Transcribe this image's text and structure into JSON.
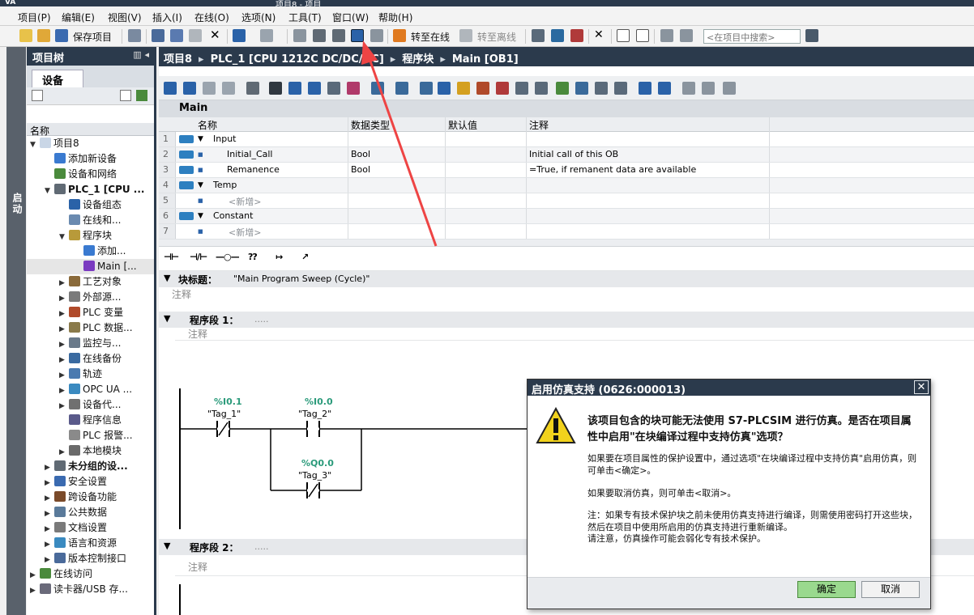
{
  "window": {
    "logo": "VA",
    "title": "项目8 - 项目"
  },
  "menu": [
    "项目(P)",
    "编辑(E)",
    "视图(V)",
    "插入(I)",
    "在线(O)",
    "选项(N)",
    "工具(T)",
    "窗口(W)",
    "帮助(H)"
  ],
  "toolbar": {
    "save_label": "保存项目",
    "go_online": "转至在线",
    "go_offline": "转至离线",
    "search_placeholder": "<在项目中搜索>"
  },
  "sidebar": {
    "vertical_tab": "启动"
  },
  "project_tree": {
    "title": "项目树",
    "controls": "▥ ◂",
    "tab": "设备",
    "column": "名称",
    "items": [
      {
        "label": "项目8",
        "indent": 0,
        "tw": "▼",
        "icon": "file-icon",
        "color": "#c9d6e6"
      },
      {
        "label": "添加新设备",
        "indent": 1,
        "tw": "",
        "icon": "add-device-icon",
        "color": "#3a7ad0"
      },
      {
        "label": "设备和网络",
        "indent": 1,
        "tw": "",
        "icon": "network-icon",
        "color": "#4a8a3c"
      },
      {
        "label": "PLC_1 [CPU ...",
        "indent": 1,
        "tw": "▼",
        "icon": "cpu-icon",
        "color": "#606a74",
        "bold": true
      },
      {
        "label": "设备组态",
        "indent": 2,
        "tw": "",
        "icon": "device-config-icon",
        "color": "#2a62a8"
      },
      {
        "label": "在线和...",
        "indent": 2,
        "tw": "",
        "icon": "online-diag-icon",
        "color": "#6a8ab0"
      },
      {
        "label": "程序块",
        "indent": 2,
        "tw": "▼",
        "icon": "program-blocks-icon",
        "color": "#b89a3a"
      },
      {
        "label": "添加...",
        "indent": 3,
        "tw": "",
        "icon": "add-block-icon",
        "color": "#3a7ad0"
      },
      {
        "label": "Main [...",
        "indent": 3,
        "tw": "",
        "icon": "ob-icon",
        "color": "#7a3ac0",
        "selected": true
      },
      {
        "label": "工艺对象",
        "indent": 2,
        "tw": "▶",
        "icon": "tech-object-icon",
        "color": "#8a6a3a"
      },
      {
        "label": "外部源...",
        "indent": 2,
        "tw": "▶",
        "icon": "external-source-icon",
        "color": "#7a7a7a"
      },
      {
        "label": "PLC 变量",
        "indent": 2,
        "tw": "▶",
        "icon": "plc-tags-icon",
        "color": "#b04a2a"
      },
      {
        "label": "PLC 数据...",
        "indent": 2,
        "tw": "▶",
        "icon": "plc-data-types-icon",
        "color": "#8a7a4a"
      },
      {
        "label": "监控与...",
        "indent": 2,
        "tw": "▶",
        "icon": "watch-table-icon",
        "color": "#6a7a8a"
      },
      {
        "label": "在线备份",
        "indent": 2,
        "tw": "▶",
        "icon": "online-backup-icon",
        "color": "#3a6aa0"
      },
      {
        "label": "轨迹",
        "indent": 2,
        "tw": "▶",
        "icon": "trace-icon",
        "color": "#4a7ab0"
      },
      {
        "label": "OPC UA ...",
        "indent": 2,
        "tw": "▶",
        "icon": "opc-ua-icon",
        "color": "#3a8ac0"
      },
      {
        "label": "设备代...",
        "indent": 2,
        "tw": "▶",
        "icon": "device-proxy-icon",
        "color": "#707070"
      },
      {
        "label": "程序信息",
        "indent": 2,
        "tw": "",
        "icon": "program-info-icon",
        "color": "#5a5a8a"
      },
      {
        "label": "PLC 报警...",
        "indent": 2,
        "tw": "",
        "icon": "plc-alarm-icon",
        "color": "#8a8a8a"
      },
      {
        "label": "本地模块",
        "indent": 2,
        "tw": "▶",
        "icon": "local-modules-icon",
        "color": "#6a6a6a"
      },
      {
        "label": "未分组的设...",
        "indent": 1,
        "tw": "▶",
        "icon": "ungrouped-devices-icon",
        "color": "#606a74",
        "bold": true
      },
      {
        "label": "安全设置",
        "indent": 1,
        "tw": "▶",
        "icon": "security-icon",
        "color": "#3a6ab0"
      },
      {
        "label": "跨设备功能",
        "indent": 1,
        "tw": "▶",
        "icon": "cross-device-icon",
        "color": "#7a4a2a"
      },
      {
        "label": "公共数据",
        "indent": 1,
        "tw": "▶",
        "icon": "common-data-icon",
        "color": "#5a7a9a"
      },
      {
        "label": "文档设置",
        "indent": 1,
        "tw": "▶",
        "icon": "document-settings-icon",
        "color": "#7a7a7a"
      },
      {
        "label": "语言和资源",
        "indent": 1,
        "tw": "▶",
        "icon": "language-icon",
        "color": "#3a8ac0"
      },
      {
        "label": "版本控制接口",
        "indent": 1,
        "tw": "▶",
        "icon": "version-control-icon",
        "color": "#4a6a9a"
      },
      {
        "label": "在线访问",
        "indent": 0,
        "tw": "▶",
        "icon": "online-access-icon",
        "color": "#4a8a3c"
      },
      {
        "label": "读卡器/USB 存...",
        "indent": 0,
        "tw": "▶",
        "icon": "card-reader-icon",
        "color": "#6a6a7a"
      }
    ]
  },
  "breadcrumb": [
    "项目8",
    "PLC_1 [CPU 1212C DC/DC/DC]",
    "程序块",
    "Main [OB1]"
  ],
  "interface": {
    "block_name": "Main",
    "columns": [
      "名称",
      "数据类型",
      "默认值",
      "注释"
    ],
    "rows": [
      {
        "num": "1",
        "name": "Input",
        "type": "",
        "comment": "",
        "section": true,
        "pin": true
      },
      {
        "num": "2",
        "name": "Initial_Call",
        "type": "Bool",
        "comment": "Initial call of this OB",
        "section": false,
        "pin": true
      },
      {
        "num": "3",
        "name": "Remanence",
        "type": "Bool",
        "comment": "=True, if remanent data are available",
        "section": false,
        "pin": true
      },
      {
        "num": "4",
        "name": "Temp",
        "type": "",
        "comment": "",
        "section": true,
        "pin": true
      },
      {
        "num": "5",
        "name": "<新增>",
        "type": "",
        "comment": "",
        "section": false,
        "pin": false,
        "placeholder": true
      },
      {
        "num": "6",
        "name": "Constant",
        "type": "",
        "comment": "",
        "section": true,
        "pin": true
      },
      {
        "num": "7",
        "name": "<新增>",
        "type": "",
        "comment": "",
        "section": false,
        "pin": false,
        "placeholder": true
      }
    ]
  },
  "ladder": {
    "block_title_label": "块标题：",
    "block_title_value": "\"Main Program Sweep (Cycle)\"",
    "comment": "注释",
    "network1": {
      "label": "程序段 1：",
      "dots": "....."
    },
    "network2": {
      "label": "程序段 2：",
      "dots": "....."
    },
    "contacts": [
      {
        "addr": "%I0.1",
        "tag": "\"Tag_1\""
      },
      {
        "addr": "%I0.0",
        "tag": "\"Tag_2\""
      },
      {
        "addr": "%Q0.0",
        "tag": "\"Tag_3\""
      }
    ],
    "toolbar_items": [
      "⊣⊢",
      "⊣/⊢",
      "—○—",
      "??",
      "↦",
      "↗"
    ]
  },
  "dialog": {
    "title": "启用仿真支持 (0626:000013)",
    "heading": "该项目包含的块可能无法使用 S7-PLCSIM 进行仿真。是否在项目属性中启用\"在块编译过程中支持仿真\"选项？",
    "p1": "如果要在项目属性的保护设置中，通过选项\"在块编译过程中支持仿真\"启用仿真，则可单击<确定>。",
    "p2": "如果要取消仿真，则可单击<取消>。",
    "p3": "注：如果专有技术保护块之前未使用仿真支持进行编译，则需使用密码打开这些块，然后在项目中使用所启用的仿真支持进行重新编译。",
    "p4": "请注意，仿真操作可能会弱化专有技术保护。",
    "ok": "确定",
    "cancel": "取消"
  }
}
